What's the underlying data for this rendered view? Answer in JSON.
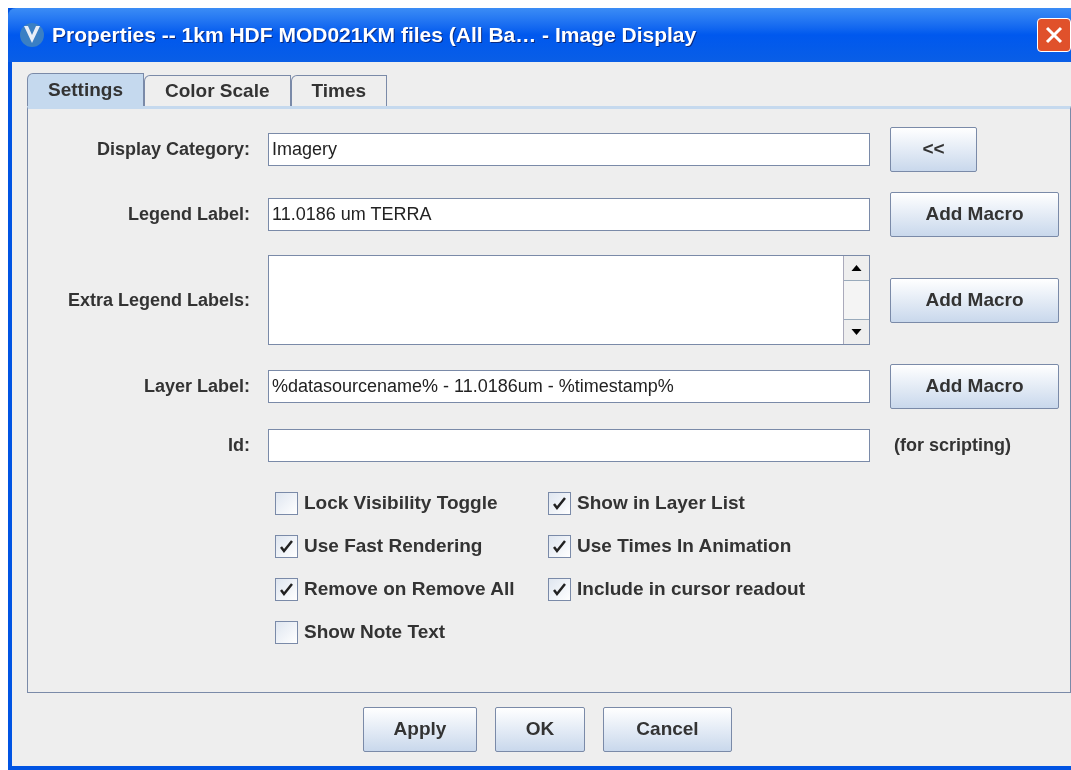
{
  "window": {
    "title": "Properties -- 1km HDF MOD021KM files (All Ba… - Image Display"
  },
  "tabs": [
    {
      "label": "Settings",
      "selected": true
    },
    {
      "label": "Color Scale",
      "selected": false
    },
    {
      "label": "Times",
      "selected": false
    }
  ],
  "fields": [
    {
      "kind": "text",
      "label": "Display Category:",
      "value": "Imagery",
      "action": "<<"
    },
    {
      "kind": "text",
      "label": "Legend Label:",
      "value": "11.0186 um TERRA",
      "action": "Add Macro"
    },
    {
      "kind": "textarea",
      "label": "Extra Legend Labels:",
      "action": "Add Macro"
    },
    {
      "kind": "text",
      "label": "Layer Label:",
      "value": "%datasourcename% - 11.0186um - %timestamp%",
      "action": "Add Macro"
    },
    {
      "kind": "text",
      "label": "Id:",
      "note": "(for scripting)"
    }
  ],
  "checkboxes": [
    {
      "label": "Lock Visibility Toggle",
      "checked": false
    },
    {
      "label": "Show in Layer List",
      "checked": true
    },
    {
      "label": "Use Fast Rendering",
      "checked": true
    },
    {
      "label": "Use Times In Animation",
      "checked": true
    },
    {
      "label": "Remove on Remove All",
      "checked": true
    },
    {
      "label": "Include in cursor readout",
      "checked": true
    },
    {
      "label": "Show Note Text",
      "checked": false
    }
  ],
  "buttons": [
    "Apply",
    "OK",
    "Cancel"
  ]
}
